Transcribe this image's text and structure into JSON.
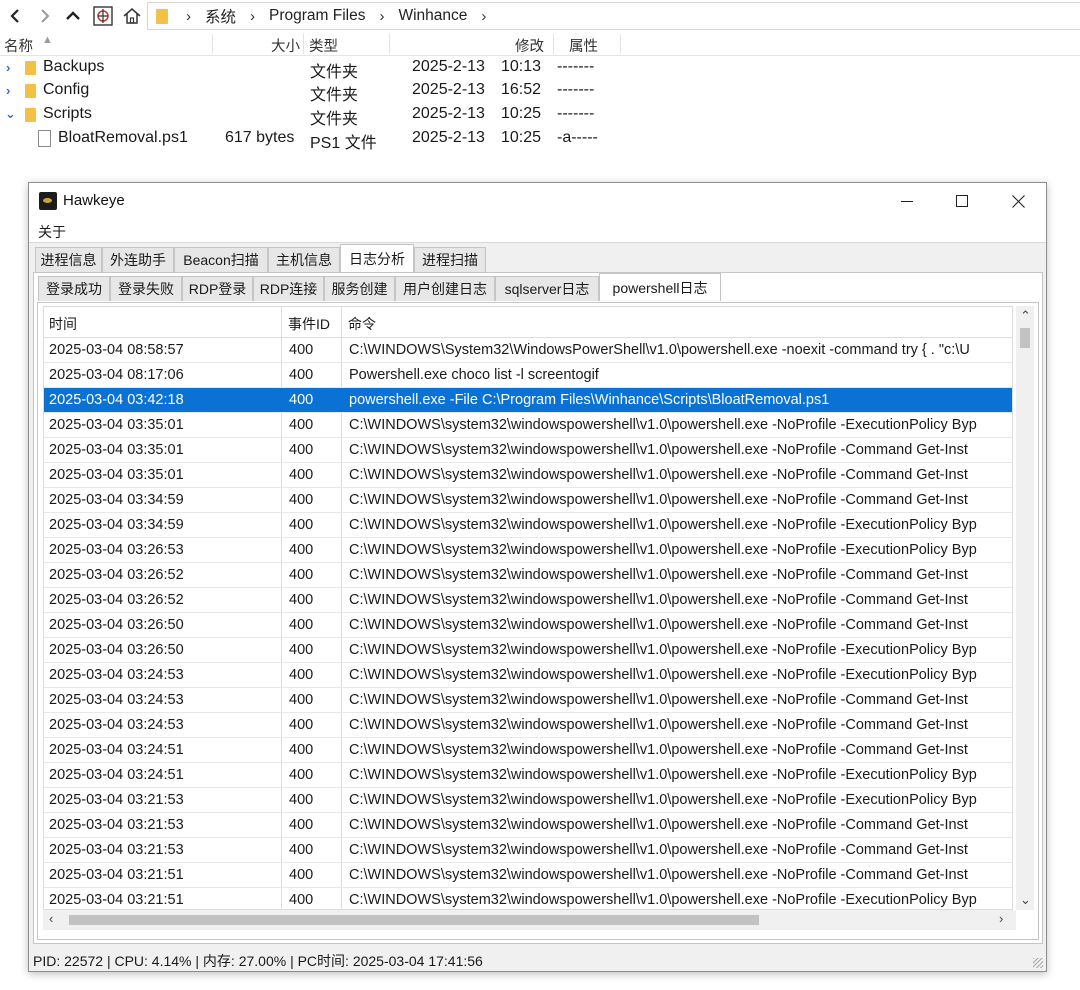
{
  "explorer": {
    "breadcrumb": [
      "系统",
      "Program Files",
      "Winhance"
    ],
    "columns": {
      "name": "名称",
      "size": "大小",
      "type": "类型",
      "modified": "修改",
      "attributes": "属性"
    },
    "files": [
      {
        "name": "Backups",
        "size": "",
        "type": "文件夹",
        "date": "2025-2-13",
        "time": "10:13",
        "attr": "-------",
        "expanded": false,
        "is_folder": true
      },
      {
        "name": "Config",
        "size": "",
        "type": "文件夹",
        "date": "2025-2-13",
        "time": "16:52",
        "attr": "-------",
        "expanded": false,
        "is_folder": true
      },
      {
        "name": "Scripts",
        "size": "",
        "type": "文件夹",
        "date": "2025-2-13",
        "time": "10:25",
        "attr": "-------",
        "expanded": true,
        "is_folder": true
      },
      {
        "name": "BloatRemoval.ps1",
        "size": "617 bytes",
        "type": "PS1 文件",
        "date": "2025-2-13",
        "time": "10:25",
        "attr": "-a-----",
        "expanded": false,
        "is_folder": false
      }
    ]
  },
  "window": {
    "title": "Hawkeye",
    "menu": [
      "关于"
    ],
    "main_tabs": [
      "进程信息",
      "外连助手",
      "Beacon扫描",
      "主机信息",
      "日志分析",
      "进程扫描"
    ],
    "main_tab_active": 4,
    "sub_tabs": [
      "登录成功",
      "登录失败",
      "RDP登录",
      "RDP连接",
      "服务创建",
      "用户创建日志",
      "sqlserver日志",
      "powershell日志"
    ],
    "sub_tab_active": 7,
    "grid": {
      "headers": [
        "时间",
        "事件ID",
        "命令"
      ],
      "selected_row": 2,
      "rows": [
        [
          "2025-03-04 08:58:57",
          "400",
          "C:\\WINDOWS\\System32\\WindowsPowerShell\\v1.0\\powershell.exe -noexit -command try { . \"c:\\U"
        ],
        [
          "2025-03-04 08:17:06",
          "400",
          "Powershell.exe choco list -l screentogif"
        ],
        [
          "2025-03-04 03:42:18",
          "400",
          "powershell.exe -File C:\\Program Files\\Winhance\\Scripts\\BloatRemoval.ps1"
        ],
        [
          "2025-03-04 03:35:01",
          "400",
          "C:\\WINDOWS\\system32\\windowspowershell\\v1.0\\powershell.exe -NoProfile -ExecutionPolicy Byp"
        ],
        [
          "2025-03-04 03:35:01",
          "400",
          "C:\\WINDOWS\\system32\\windowspowershell\\v1.0\\powershell.exe -NoProfile -Command Get-Inst"
        ],
        [
          "2025-03-04 03:35:01",
          "400",
          "C:\\WINDOWS\\system32\\windowspowershell\\v1.0\\powershell.exe -NoProfile -Command Get-Inst"
        ],
        [
          "2025-03-04 03:34:59",
          "400",
          "C:\\WINDOWS\\system32\\windowspowershell\\v1.0\\powershell.exe -NoProfile -Command Get-Inst"
        ],
        [
          "2025-03-04 03:34:59",
          "400",
          "C:\\WINDOWS\\system32\\windowspowershell\\v1.0\\powershell.exe -NoProfile -ExecutionPolicy Byp"
        ],
        [
          "2025-03-04 03:26:53",
          "400",
          "C:\\WINDOWS\\system32\\windowspowershell\\v1.0\\powershell.exe -NoProfile -ExecutionPolicy Byp"
        ],
        [
          "2025-03-04 03:26:52",
          "400",
          "C:\\WINDOWS\\system32\\windowspowershell\\v1.0\\powershell.exe -NoProfile -Command Get-Inst"
        ],
        [
          "2025-03-04 03:26:52",
          "400",
          "C:\\WINDOWS\\system32\\windowspowershell\\v1.0\\powershell.exe -NoProfile -Command Get-Inst"
        ],
        [
          "2025-03-04 03:26:50",
          "400",
          "C:\\WINDOWS\\system32\\windowspowershell\\v1.0\\powershell.exe -NoProfile -Command Get-Inst"
        ],
        [
          "2025-03-04 03:26:50",
          "400",
          "C:\\WINDOWS\\system32\\windowspowershell\\v1.0\\powershell.exe -NoProfile -ExecutionPolicy Byp"
        ],
        [
          "2025-03-04 03:24:53",
          "400",
          "C:\\WINDOWS\\system32\\windowspowershell\\v1.0\\powershell.exe -NoProfile -ExecutionPolicy Byp"
        ],
        [
          "2025-03-04 03:24:53",
          "400",
          "C:\\WINDOWS\\system32\\windowspowershell\\v1.0\\powershell.exe -NoProfile -Command Get-Inst"
        ],
        [
          "2025-03-04 03:24:53",
          "400",
          "C:\\WINDOWS\\system32\\windowspowershell\\v1.0\\powershell.exe -NoProfile -Command Get-Inst"
        ],
        [
          "2025-03-04 03:24:51",
          "400",
          "C:\\WINDOWS\\system32\\windowspowershell\\v1.0\\powershell.exe -NoProfile -Command Get-Inst"
        ],
        [
          "2025-03-04 03:24:51",
          "400",
          "C:\\WINDOWS\\system32\\windowspowershell\\v1.0\\powershell.exe -NoProfile -ExecutionPolicy Byp"
        ],
        [
          "2025-03-04 03:21:53",
          "400",
          "C:\\WINDOWS\\system32\\windowspowershell\\v1.0\\powershell.exe -NoProfile -ExecutionPolicy Byp"
        ],
        [
          "2025-03-04 03:21:53",
          "400",
          "C:\\WINDOWS\\system32\\windowspowershell\\v1.0\\powershell.exe -NoProfile -Command Get-Inst"
        ],
        [
          "2025-03-04 03:21:53",
          "400",
          "C:\\WINDOWS\\system32\\windowspowershell\\v1.0\\powershell.exe -NoProfile -Command Get-Inst"
        ],
        [
          "2025-03-04 03:21:51",
          "400",
          "C:\\WINDOWS\\system32\\windowspowershell\\v1.0\\powershell.exe -NoProfile -Command Get-Inst"
        ],
        [
          "2025-03-04 03:21:51",
          "400",
          "C:\\WINDOWS\\system32\\windowspowershell\\v1.0\\powershell.exe -NoProfile -ExecutionPolicy Byp"
        ]
      ]
    },
    "status": "PID: 22572 | CPU: 4.14% | 内存: 27.00% | PC时间: 2025-03-04 17:41:56"
  },
  "colors": {
    "selection": "#0a72d4",
    "folder": "#f3bf45",
    "chevron": "#2d6cc7"
  },
  "icons": [
    "back-arrow-icon",
    "forward-arrow-icon",
    "up-arrow-icon",
    "pin-icon",
    "home-icon",
    "folder-icon",
    "chevron-right-icon",
    "chevron-down-icon",
    "file-icon",
    "app-icon",
    "minimize-icon",
    "maximize-icon",
    "close-icon",
    "sort-ascending-icon"
  ]
}
